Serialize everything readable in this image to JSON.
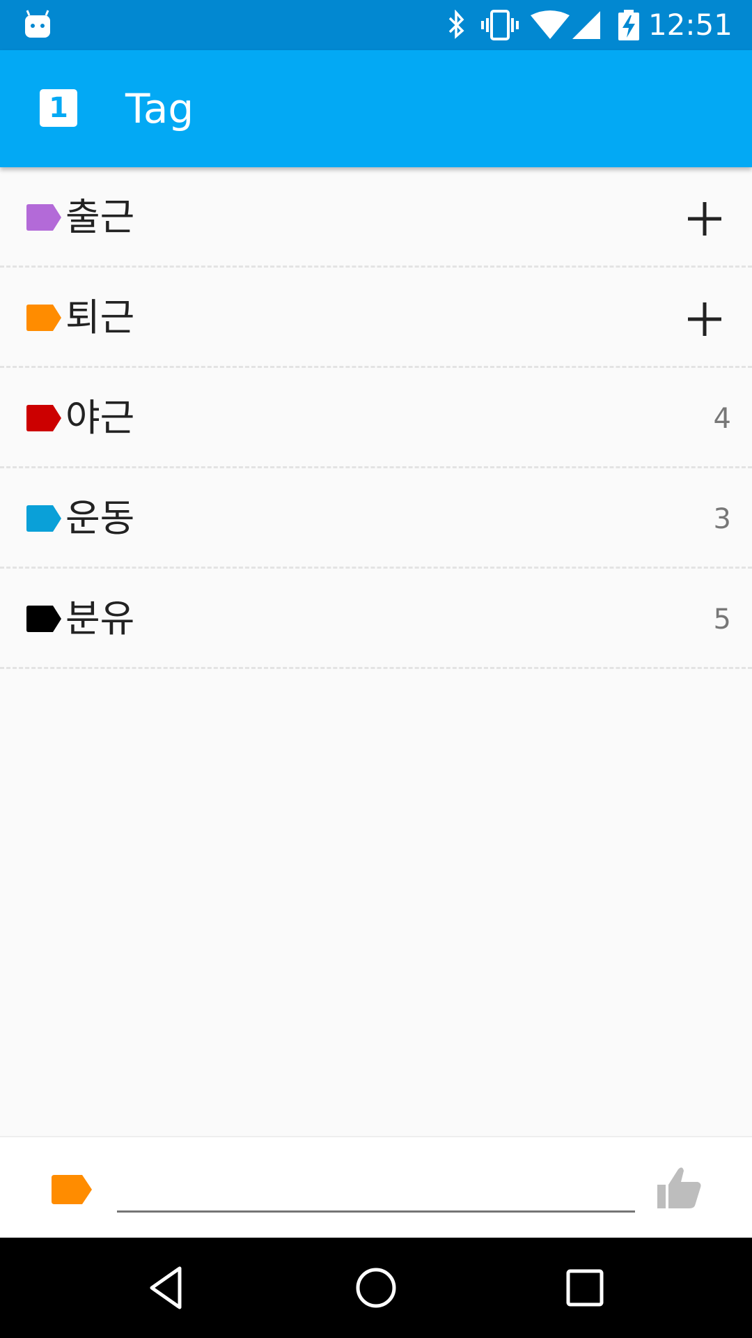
{
  "status_bar": {
    "time": "12:51",
    "icons": [
      "notification-bot-icon",
      "bluetooth-icon",
      "vibrate-icon",
      "wifi-icon",
      "signal-icon",
      "battery-charging-icon"
    ]
  },
  "app_bar": {
    "logo_text": "1",
    "title": "Tag"
  },
  "tags": [
    {
      "name": "출근",
      "color": "#b36ad8",
      "trailing": "add",
      "count": ""
    },
    {
      "name": "퇴근",
      "color": "#ff8c00",
      "trailing": "add",
      "count": ""
    },
    {
      "name": "야근",
      "color": "#cc0000",
      "trailing": "count",
      "count": "4"
    },
    {
      "name": "운동",
      "color": "#0aa0d8",
      "trailing": "count",
      "count": "3"
    },
    {
      "name": "분유",
      "color": "#000000",
      "trailing": "count",
      "count": "5"
    }
  ],
  "input_bar": {
    "tag_color": "#ff8c00",
    "value": "",
    "placeholder": ""
  },
  "colors": {
    "status_bar": "#0288d1",
    "app_bar": "#03a9f4",
    "background": "#fafafa"
  }
}
